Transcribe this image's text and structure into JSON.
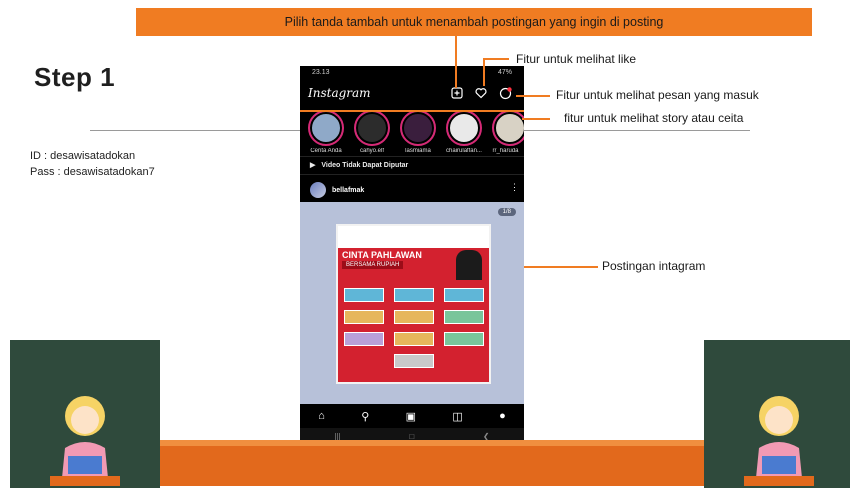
{
  "banner": {
    "text": "Pilih tanda tambah untuk menambah postingan yang ingin di posting"
  },
  "step": {
    "title": "Step 1"
  },
  "credentials": {
    "id": "ID : desawisatadokan",
    "pass": "Pass : desawisatadokan7"
  },
  "phone": {
    "status_time": "23.13",
    "status_right": "47%",
    "app_name": "Instagram",
    "stories": [
      {
        "name": "Cerita Anda"
      },
      {
        "name": "cahyo.elf"
      },
      {
        "name": "lasmiama"
      },
      {
        "name": "chairulaffan..."
      },
      {
        "name": "rr_haruda"
      }
    ],
    "notice": "Video Tidak Dapat Diputar",
    "post_user": "bellafmak",
    "post_counter": "1/8",
    "poster_title": "CINTA PAHLAWAN",
    "poster_subtitle": "BERSAMA RUPIAH"
  },
  "callouts": {
    "like": "Fitur untuk melihat like",
    "messages": "Fitur untuk melihat pesan yang masuk",
    "story": "fitur untuk melihat story atau ceita",
    "post": "Postingan intagram"
  },
  "colors": {
    "accent": "#f07c22",
    "stage": "#e2691c",
    "board": "#2f4a3c"
  }
}
